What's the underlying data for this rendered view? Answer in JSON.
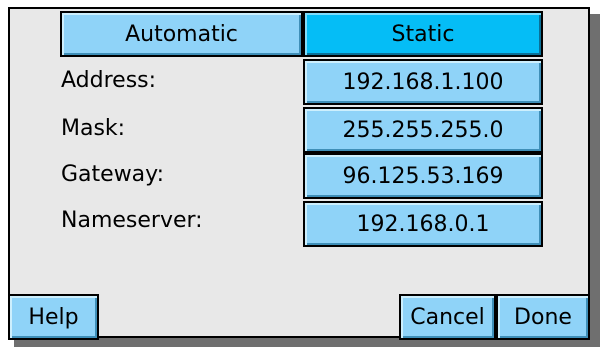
{
  "mode_tabs": {
    "automatic_label": "Automatic",
    "static_label": "Static",
    "selected": "Static"
  },
  "fields": [
    {
      "label": "Address:",
      "value": "192.168.1.100"
    },
    {
      "label": "Mask:",
      "value": "255.255.255.0"
    },
    {
      "label": "Gateway:",
      "value": "96.125.53.169"
    },
    {
      "label": "Nameserver:",
      "value": "192.168.0.1"
    }
  ],
  "footer": {
    "help_label": "Help",
    "cancel_label": "Cancel",
    "done_label": "Done"
  },
  "colors": {
    "button": "#8fd3f8",
    "selected_button": "#05bdf6",
    "panel": "#e8e8e8",
    "border": "#000000"
  }
}
